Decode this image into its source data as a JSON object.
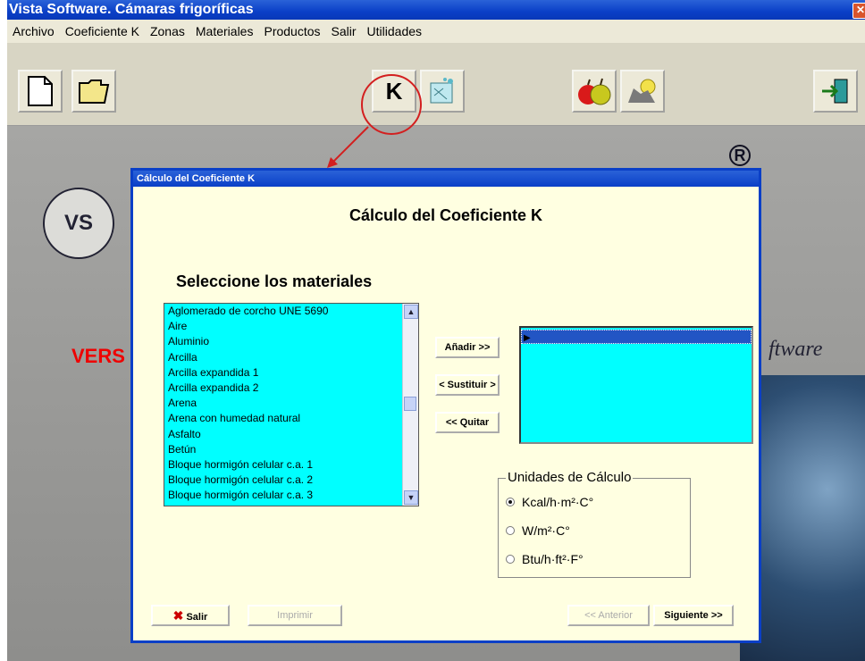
{
  "window": {
    "title": "Vista Software. Cámaras frigoríficas",
    "close": "✕"
  },
  "menu": [
    "Archivo",
    "Coeficiente K",
    "Zonas",
    "Materiales",
    "Productos",
    "Salir",
    "Utilidades"
  ],
  "toolbar": {
    "k_label": "K"
  },
  "background": {
    "logo": "VS",
    "brand_left": "VERS",
    "brand_right": "ftware",
    "registered": "R"
  },
  "dialog": {
    "title": "Cálculo del Coeficiente K",
    "heading": "Cálculo del Coeficiente K",
    "select_label": "Seleccione los materiales",
    "materials": [
      "Aglomerado de corcho UNE 5690",
      "Aire",
      "Aluminio",
      "Arcilla",
      "Arcilla expandida 1",
      "Arcilla expandida 2",
      "Arena",
      "Arena con humedad natural",
      "Asfalto",
      "Betún",
      "Bloque hormigón celular c.a. 1",
      "Bloque hormigón celular c.a. 2",
      "Bloque hormigón celular c.a. 3"
    ],
    "add_button": "Añadir >>",
    "replace_button": "< Sustituir >",
    "remove_button": "<< Quitar",
    "units": {
      "legend": "Unidades de Cálculo",
      "options": [
        "Kcal/h·m²·C°",
        "W/m²·C°",
        "Btu/h·ft²·F°"
      ],
      "selected_index": 0
    },
    "exit_button": "Salir",
    "print_button": "Imprimir",
    "prev_button": "<< Anterior",
    "next_button": "Siguiente >>"
  }
}
